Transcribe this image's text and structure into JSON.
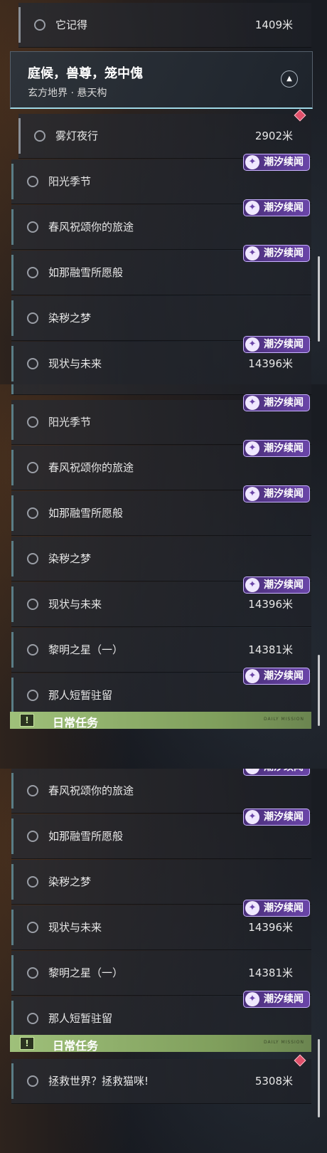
{
  "badge_label": "潮汐续闻",
  "badge_icon": "tide-quest-icon",
  "header": {
    "title": "庭候，兽尊，笼中傀",
    "subtitle": "玄方地界 · 悬天构"
  },
  "daily_label": "日常任务",
  "daily_small": "DAILY MISSION",
  "panel1": {
    "items": [
      {
        "title": "它记得",
        "distance": "1409米"
      },
      {
        "title": "雾灯夜行",
        "distance": "2902米"
      },
      {
        "title": "阳光季节"
      },
      {
        "title": "春风祝颂你的旅途"
      },
      {
        "title": "如那融雪所愿般"
      },
      {
        "title": "染秽之梦"
      },
      {
        "title": "现状与未来",
        "distance": "14396米"
      }
    ]
  },
  "panel2": {
    "items": [
      {
        "title": "阳光季节"
      },
      {
        "title": "春风祝颂你的旅途"
      },
      {
        "title": "如那融雪所愿般"
      },
      {
        "title": "染秽之梦"
      },
      {
        "title": "现状与未来",
        "distance": "14396米"
      },
      {
        "title": "黎明之星（一）",
        "distance": "14381米"
      },
      {
        "title": "那人短暂驻留"
      }
    ]
  },
  "panel3": {
    "items": [
      {
        "title": "春风祝颂你的旅途"
      },
      {
        "title": "如那融雪所愿般"
      },
      {
        "title": "染秽之梦"
      },
      {
        "title": "现状与未来",
        "distance": "14396米"
      },
      {
        "title": "黎明之星（一）",
        "distance": "14381米"
      },
      {
        "title": "那人短暂驻留"
      },
      {
        "title": "拯救世界？拯救猫咪!",
        "distance": "5308米"
      }
    ]
  }
}
